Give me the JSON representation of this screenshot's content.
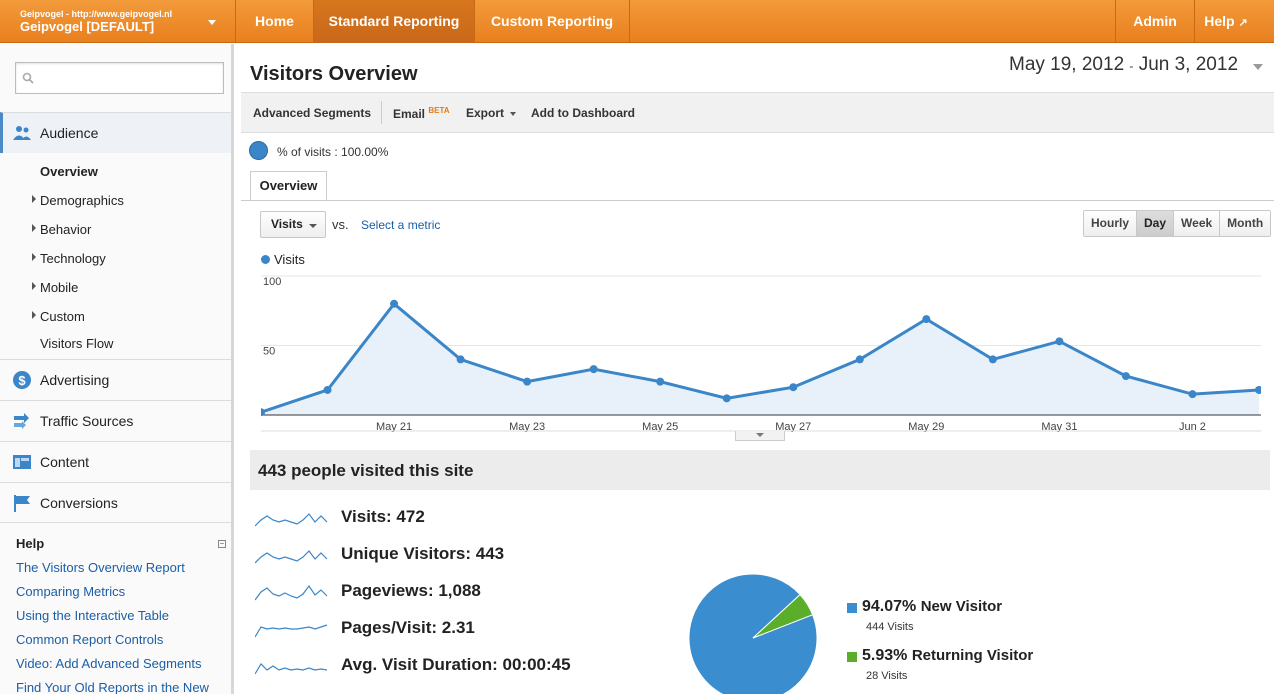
{
  "account": {
    "url_line": "Geipvogel - http://www.geipvogel.nl",
    "name": "Geipvogel [DEFAULT]"
  },
  "nav": {
    "tabs": [
      {
        "label": "Home"
      },
      {
        "label": "Standard Reporting"
      },
      {
        "label": "Custom Reporting"
      }
    ],
    "admin": "Admin",
    "help": "Help"
  },
  "sidebar": {
    "search": {
      "value": "",
      "placeholder": ""
    },
    "sections": [
      {
        "label": "Audience"
      },
      {
        "label": "Advertising"
      },
      {
        "label": "Traffic Sources"
      },
      {
        "label": "Content"
      },
      {
        "label": "Conversions"
      }
    ],
    "audience_items": [
      {
        "label": "Overview"
      },
      {
        "label": "Demographics"
      },
      {
        "label": "Behavior"
      },
      {
        "label": "Technology"
      },
      {
        "label": "Mobile"
      },
      {
        "label": "Custom"
      },
      {
        "label": "Visitors Flow"
      }
    ],
    "help": {
      "title": "Help",
      "links": [
        {
          "label": "The Visitors Overview Report"
        },
        {
          "label": "Comparing Metrics"
        },
        {
          "label": "Using the Interactive Table"
        },
        {
          "label": "Common Report Controls"
        },
        {
          "label": "Video: Add Advanced Segments"
        },
        {
          "label": "Find Your Old Reports in the New"
        }
      ]
    }
  },
  "page": {
    "title": "Visitors Overview",
    "date_start": "May 19, 2012",
    "date_sep": "-",
    "date_end": "Jun 3, 2012"
  },
  "toolbar": {
    "segments": "Advanced Segments",
    "email": "Email",
    "email_badge": "BETA",
    "export": "Export",
    "dashboard": "Add to Dashboard"
  },
  "segment": {
    "label": "% of visits : 100.00%"
  },
  "tabs": {
    "overview": "Overview"
  },
  "chart_controls": {
    "metric": "Visits",
    "vs": "vs.",
    "select_metric": "Select a metric",
    "granularity": [
      "Hourly",
      "Day",
      "Week",
      "Month"
    ],
    "selected_granularity": "Day"
  },
  "chart_data": {
    "type": "area",
    "series": [
      {
        "name": "Visits",
        "values": [
          2,
          18,
          80,
          40,
          24,
          33,
          24,
          12,
          20,
          40,
          69,
          40,
          53,
          28,
          15,
          18
        ]
      }
    ],
    "x": [
      "May 19",
      "May 20",
      "May 21",
      "May 22",
      "May 23",
      "May 24",
      "May 25",
      "May 26",
      "May 27",
      "May 28",
      "May 29",
      "May 30",
      "May 31",
      "Jun 1",
      "Jun 2",
      "Jun 3"
    ],
    "x_tick_labels": [
      "May 21",
      "May 23",
      "May 25",
      "May 27",
      "May 29",
      "May 31",
      "Jun 2"
    ],
    "y_tick_labels": [
      "100",
      "50"
    ],
    "ylim": [
      0,
      100
    ],
    "grid": true,
    "color": "#3a86c8"
  },
  "summary": {
    "title": "443 people visited this site",
    "metrics": [
      {
        "label": "Visits: 472"
      },
      {
        "label": "Unique Visitors: 443"
      },
      {
        "label": "Pageviews: 1,088"
      },
      {
        "label": "Pages/Visit: 2.31"
      },
      {
        "label": "Avg. Visit Duration: 00:00:45"
      }
    ]
  },
  "pie": {
    "slices": [
      {
        "pct": "94.07%",
        "name": "New Visitor",
        "visits": "444 Visits",
        "value": 94.07,
        "color": "#3a8dce"
      },
      {
        "pct": "5.93%",
        "name": "Returning Visitor",
        "visits": "28 Visits",
        "value": 5.93,
        "color": "#5aae2a"
      }
    ]
  },
  "colors": {
    "accent": "#e8801f",
    "link": "#1a5ea8",
    "series": "#3a86c8"
  }
}
